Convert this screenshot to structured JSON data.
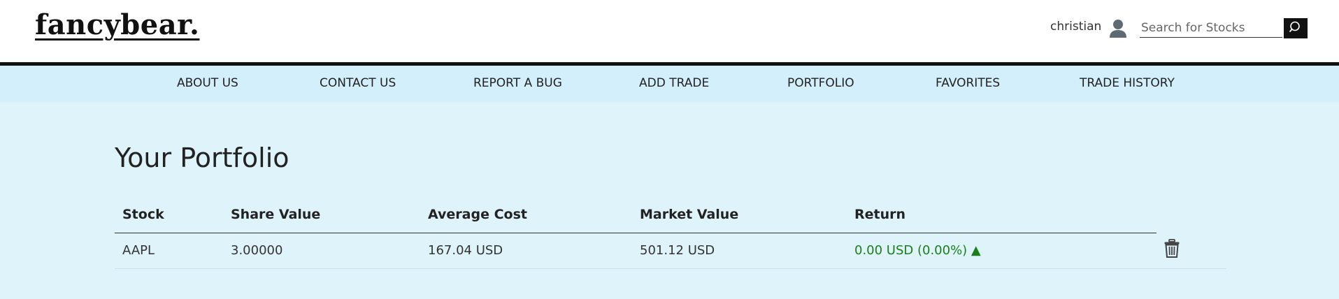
{
  "header": {
    "logo": "fancybear.",
    "username": "christian",
    "search": {
      "placeholder": "Search for Stocks",
      "value": ""
    }
  },
  "nav": {
    "items": [
      {
        "label": "ABOUT US"
      },
      {
        "label": "CONTACT US"
      },
      {
        "label": "REPORT A BUG"
      },
      {
        "label": "ADD TRADE"
      },
      {
        "label": "PORTFOLIO"
      },
      {
        "label": "FAVORITES"
      },
      {
        "label": "TRADE HISTORY"
      }
    ]
  },
  "main": {
    "title": "Your Portfolio",
    "table": {
      "columns": [
        "Stock",
        "Share Value",
        "Average Cost",
        "Market Value",
        "Return"
      ],
      "rows": [
        {
          "stock": "AAPL",
          "share_value": "3.00000",
          "average_cost": "167.04 USD",
          "market_value": "501.12 USD",
          "return": "0.00 USD (0.00%) ▲"
        }
      ]
    }
  },
  "icons": {
    "user": "user-icon",
    "search": "search-icon",
    "delete": "trash-icon"
  },
  "colors": {
    "nav_bg": "#d3effb",
    "page_bg": "#dff3fb",
    "return_positive": "#1a7f1a",
    "search_button": "#111111"
  }
}
